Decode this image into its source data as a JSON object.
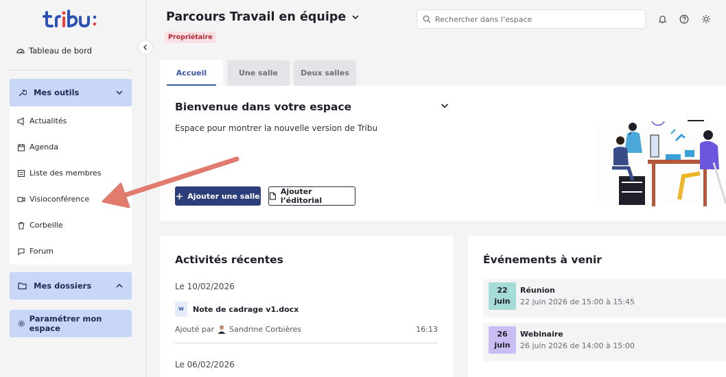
{
  "brand": {
    "logo_text": "tribu",
    "colors": {
      "blue": "#2d52b7",
      "red": "#e9423b",
      "accent": "#2d3f7b"
    }
  },
  "sidebar": {
    "dashboard_label": "Tableau de bord",
    "tools_group": {
      "label": "Mes outils",
      "expanded": true
    },
    "tools": [
      {
        "label": "Actualités",
        "icon": "megaphone-icon"
      },
      {
        "label": "Agenda",
        "icon": "calendar-icon"
      },
      {
        "label": "Liste des membres",
        "icon": "list-icon"
      },
      {
        "label": "Visioconférence",
        "icon": "video-icon"
      },
      {
        "label": "Corbeille",
        "icon": "trash-icon"
      },
      {
        "label": "Forum",
        "icon": "chat-icon"
      }
    ],
    "folders_group": {
      "label": "Mes dossiers",
      "expanded": false
    },
    "settings_label": "Paramétrer mon espace"
  },
  "header": {
    "title": "Parcours Travail en équipe",
    "badge": "Propriétaire",
    "search_placeholder": "Rechercher dans l’espace"
  },
  "tabs": [
    {
      "label": "Accueil",
      "active": true
    },
    {
      "label": "Une salle",
      "active": false
    },
    {
      "label": "Deux salles",
      "active": false
    }
  ],
  "welcome": {
    "title": "Bienvenue dans votre espace",
    "description": "Espace pour montrer la nouvelle version de Tribu",
    "add_room_label": "Ajouter une salle",
    "add_editorial_label": "Ajouter l’éditorial"
  },
  "activities": {
    "title": "Activités récentes",
    "groups": [
      {
        "date": "Le 10/02/2026",
        "items": [
          {
            "file_type": "W",
            "name": "Note de cadrage v1.docx",
            "added_by_prefix": "Ajouté par",
            "author": "Sandrine Corbières",
            "time": "16:13"
          }
        ]
      },
      {
        "date": "Le 06/02/2026",
        "items": []
      }
    ]
  },
  "events": {
    "title": "Événements à venir",
    "items": [
      {
        "day": "22",
        "month": "juin",
        "name": "Réunion",
        "datetime": "22 juin 2026 de 15:00 à 15:45",
        "color": "#a6dcd8"
      },
      {
        "day": "26",
        "month": "juin",
        "name": "Webinaire",
        "datetime": "26 juin 2026 de 14:00 à 15:00",
        "color": "#c9bdf4"
      }
    ]
  },
  "annotation": {
    "type": "arrow",
    "color": "#e07b6e",
    "points_to": "Visioconférence"
  }
}
